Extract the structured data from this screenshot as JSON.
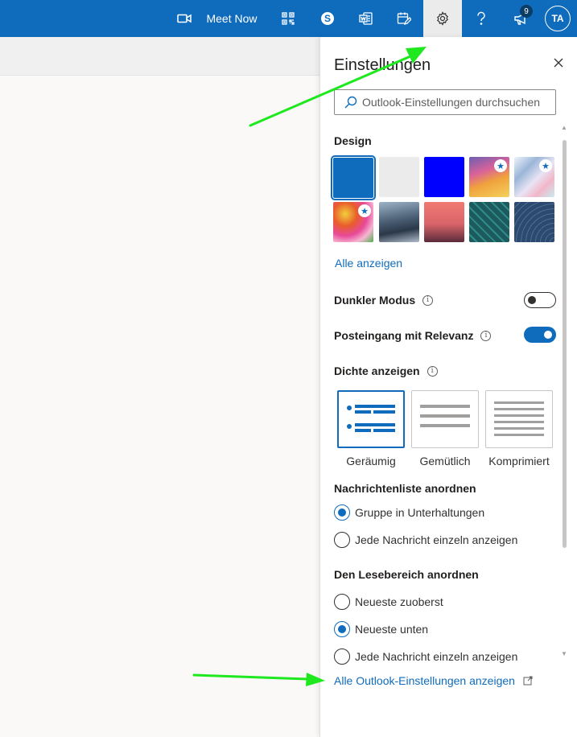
{
  "topbar": {
    "meet_now_label": "Meet Now",
    "notification_count": "9",
    "avatar_initials": "TA",
    "bar_color": "#0f6cbd",
    "icons": [
      "video-icon",
      "qr-code-icon",
      "skype-icon",
      "office-word-icon",
      "calendar-edit-icon",
      "gear-icon",
      "help-icon",
      "megaphone-icon"
    ]
  },
  "settings": {
    "title": "Einstellungen",
    "search_placeholder": "Outlook-Einstellungen durchsuchen",
    "design": {
      "heading": "Design",
      "show_all_label": "Alle anzeigen",
      "themes": [
        {
          "name": "blue",
          "color": "#0f6cbd",
          "selected": true,
          "star": false
        },
        {
          "name": "light-gray",
          "color": "#ebebeb",
          "selected": false,
          "star": false
        },
        {
          "name": "bright-blue",
          "color": "#0000ff",
          "selected": false,
          "star": false
        },
        {
          "name": "rainbow",
          "color": "#d98a4a",
          "selected": false,
          "star": true
        },
        {
          "name": "iridescent",
          "color": "#9bb6d8",
          "selected": false,
          "star": true
        },
        {
          "name": "flowers",
          "color": "#e8a040",
          "selected": false,
          "star": true
        },
        {
          "name": "mountains",
          "color": "#4a5e74",
          "selected": false,
          "star": false
        },
        {
          "name": "palm-sunset",
          "color": "#d9646a",
          "selected": false,
          "star": false
        },
        {
          "name": "circuit",
          "color": "#1c5a5e",
          "selected": false,
          "star": false
        },
        {
          "name": "elevation",
          "color": "#2c4a6e",
          "selected": false,
          "star": false
        }
      ]
    },
    "dark_mode": {
      "label": "Dunkler Modus",
      "on": false
    },
    "focused_inbox": {
      "label": "Posteingang mit Relevanz",
      "on": true
    },
    "density": {
      "heading": "Dichte anzeigen",
      "options": [
        {
          "label": "Geräumig",
          "selected": true
        },
        {
          "label": "Gemütlich",
          "selected": false
        },
        {
          "label": "Komprimiert",
          "selected": false
        }
      ]
    },
    "message_list": {
      "heading": "Nachrichtenliste anordnen",
      "options": [
        {
          "label": "Gruppe in Unterhaltungen",
          "checked": true
        },
        {
          "label": "Jede Nachricht einzeln anzeigen",
          "checked": false
        }
      ]
    },
    "reading_pane": {
      "heading": "Den Lesebereich anordnen",
      "options": [
        {
          "label": "Neueste zuoberst",
          "checked": false
        },
        {
          "label": "Neueste unten",
          "checked": true
        },
        {
          "label": "Jede Nachricht einzeln anzeigen",
          "checked": false
        }
      ]
    },
    "all_settings_link": "Alle Outlook-Einstellungen anzeigen"
  },
  "annotations": {
    "arrow_color": "#1ee81e"
  }
}
